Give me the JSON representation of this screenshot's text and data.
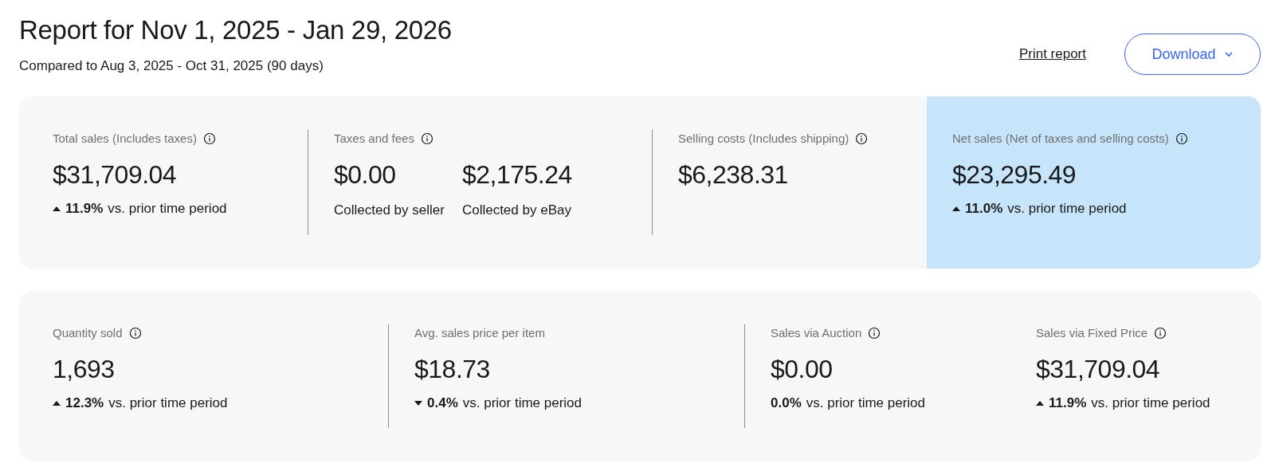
{
  "header": {
    "title": "Report for Nov 1, 2025 - Jan 29, 2026",
    "subtitle": "Compared to Aug 3, 2025 - Oct 31, 2025 (90 days)",
    "print_link": "Print report",
    "download_button": "Download"
  },
  "cards": [
    {
      "groups": [
        {
          "label": "Total sales (Includes taxes)",
          "info": true,
          "highlighted": false,
          "metrics": [
            {
              "value": "$31,709.04"
            }
          ],
          "change": {
            "kind": "up",
            "percent": "11.9%",
            "text": "vs. prior time period"
          }
        },
        {
          "label": "Taxes and fees",
          "info": true,
          "highlighted": false,
          "metrics": [
            {
              "value": "$0.00",
              "caption": "Collected by seller"
            },
            {
              "value": "$2,175.24",
              "caption": "Collected by eBay"
            }
          ]
        },
        {
          "label": "Selling costs (Includes shipping)",
          "info": true,
          "highlighted": false,
          "metrics": [
            {
              "value": "$6,238.31"
            }
          ]
        },
        {
          "label": "Net sales (Net of taxes and selling costs)",
          "info": true,
          "highlighted": true,
          "metrics": [
            {
              "value": "$23,295.49"
            }
          ],
          "change": {
            "kind": "up",
            "percent": "11.0%",
            "text": "vs. prior time period"
          }
        }
      ]
    },
    {
      "groups": [
        {
          "label": "Quantity sold",
          "info": true,
          "highlighted": false,
          "metrics": [
            {
              "value": "1,693"
            }
          ],
          "change": {
            "kind": "up",
            "percent": "12.3%",
            "text": "vs. prior time period"
          }
        },
        {
          "label": "Avg. sales price per item",
          "info": false,
          "highlighted": false,
          "metrics": [
            {
              "value": "$18.73"
            }
          ],
          "change": {
            "kind": "down",
            "percent": "0.4%",
            "text": "vs. prior time period"
          }
        },
        {
          "label": "Sales via Auction",
          "info": true,
          "highlighted": false,
          "metrics": [
            {
              "value": "$0.00"
            }
          ],
          "change": {
            "kind": "flat",
            "percent": "0.0%",
            "text": "vs. prior time period"
          }
        },
        {
          "label": "Sales via Fixed Price",
          "info": true,
          "highlighted": false,
          "metrics": [
            {
              "value": "$31,709.04"
            }
          ],
          "change": {
            "kind": "up",
            "percent": "11.9%",
            "text": "vs. prior time period"
          }
        }
      ]
    }
  ]
}
